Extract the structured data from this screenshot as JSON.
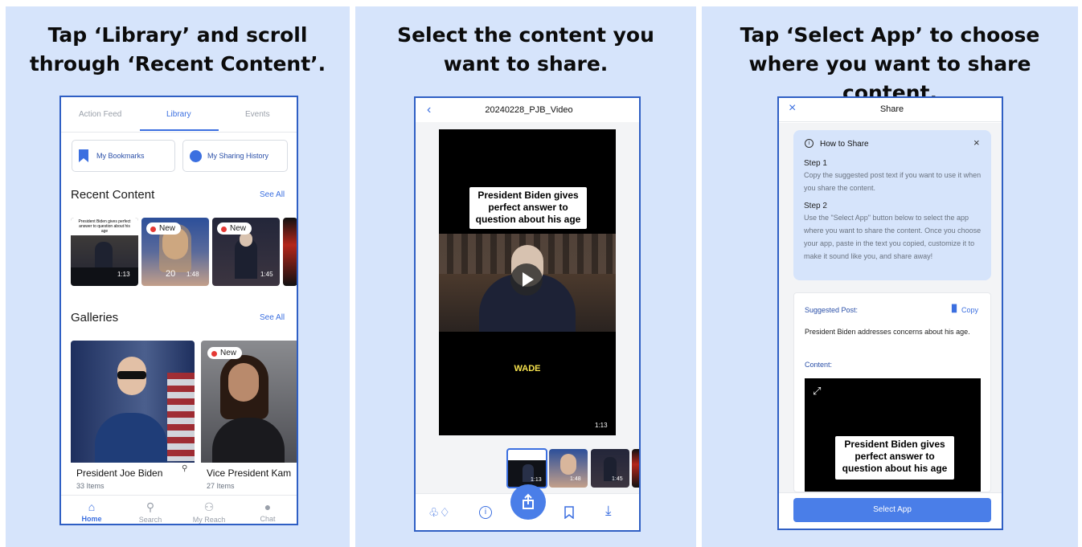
{
  "panels": {
    "p1": {
      "heading": "Tap ‘Library’ and scroll through ‘Recent Content’."
    },
    "p2": {
      "heading": "Select the content you want to share."
    },
    "p3": {
      "heading": "Tap ‘Select App’ to choose where you want to share content."
    }
  },
  "library": {
    "tabs": [
      "Action Feed",
      "Library",
      "Events"
    ],
    "active_tab": "Library",
    "bookmarks_label": "My Bookmarks",
    "sharing_history_label": "My Sharing History",
    "recent_title": "Recent Content",
    "see_all": "See All",
    "recent": [
      {
        "caption": "President Biden gives perfect answer to question about his age",
        "duration": "1:13",
        "new": false,
        "lower": "WADE"
      },
      {
        "caption": "",
        "duration": "1:48",
        "new": true,
        "new_label": "New",
        "lower": "20"
      },
      {
        "caption": "",
        "duration": "1:45",
        "new": true,
        "new_label": "New"
      },
      {
        "caption": "",
        "duration": "",
        "new": false
      }
    ],
    "galleries_title": "Galleries",
    "galleries": [
      {
        "title": "President Joe Biden",
        "count": "33 Items",
        "new": false
      },
      {
        "title": "Vice President Kam",
        "count": "27 Items",
        "new": true,
        "new_label": "New"
      }
    ],
    "nav": [
      "Home",
      "Search",
      "My Reach",
      "Chat"
    ],
    "active_nav": "Home"
  },
  "video": {
    "back_icon": "chevron-left-icon",
    "title": "20240228_PJB_Video",
    "caption": "President Biden gives perfect answer to question about his age",
    "lower_text": "WADE",
    "duration": "1:13",
    "strip": [
      {
        "duration": "1:13"
      },
      {
        "duration": "1:48"
      },
      {
        "duration": "1:45"
      },
      {
        "duration": ""
      }
    ],
    "accent": "#4a7ee8"
  },
  "share": {
    "title": "Share",
    "how_title": "How to Share",
    "step1_title": "Step 1",
    "step1_body": "Copy the suggested post text if you want to use it when you share the content.",
    "step2_title": "Step 2",
    "step2_body": "Use the \"Select App\" button below to select the app where you want to share the content. Once you choose your app, paste in the text you copied, customize it to make it sound like you, and share away!",
    "suggested_label": "Suggested Post:",
    "copy_label": "Copy",
    "post_text": "President Biden addresses concerns about his age.",
    "content_label": "Content:",
    "preview_caption": "President Biden gives perfect answer to question about his age",
    "button": "Select App"
  }
}
